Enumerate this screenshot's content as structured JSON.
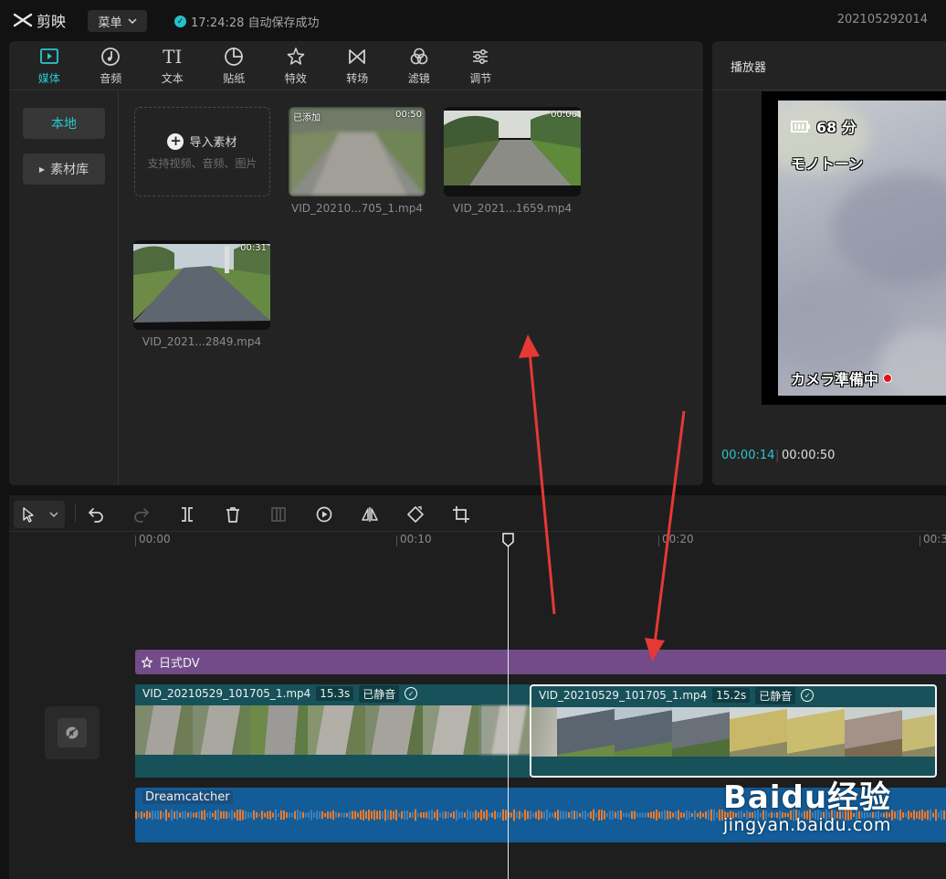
{
  "app": {
    "name": "剪映"
  },
  "titlebar": {
    "menu_label": "菜单",
    "autosave_text": "17:24:28 自动保存成功",
    "project_name": "202105292014"
  },
  "tool_tabs": [
    {
      "label": "媒体",
      "icon": "media-icon",
      "active": true
    },
    {
      "label": "音频",
      "icon": "audio-icon"
    },
    {
      "label": "文本",
      "icon": "text-icon"
    },
    {
      "label": "贴纸",
      "icon": "sticker-icon"
    },
    {
      "label": "特效",
      "icon": "effects-icon"
    },
    {
      "label": "转场",
      "icon": "transition-icon"
    },
    {
      "label": "滤镜",
      "icon": "filter-icon"
    },
    {
      "label": "调节",
      "icon": "adjust-icon"
    }
  ],
  "media_sidebar": {
    "local": "本地",
    "library": "素材库"
  },
  "import": {
    "label": "导入素材",
    "hint": "支持视频、音频、图片"
  },
  "media_items": [
    {
      "name": "VID_20210...705_1.mp4",
      "duration": "00:50",
      "badge": "已添加"
    },
    {
      "name": "VID_2021...1659.mp4",
      "duration": "00:06"
    },
    {
      "name": "VID_2021...2849.mp4",
      "duration": "00:31"
    }
  ],
  "player": {
    "title": "播放器",
    "current_time": "00:00:14",
    "separator": "|",
    "total_time": "00:00:50",
    "osd": {
      "battery": "68 分",
      "mode": "モノトーン",
      "status": "カメラ準備中"
    }
  },
  "ruler": {
    "labels": [
      "00:00",
      "00:10",
      "00:20",
      "00:3"
    ]
  },
  "tracks": {
    "effect": {
      "label": "日式DV"
    },
    "clips": [
      {
        "name": "VID_20210529_101705_1.mp4",
        "duration": "15.3s",
        "muted": "已静音"
      },
      {
        "name": "VID_20210529_101705_1.mp4",
        "duration": "15.2s",
        "muted": "已静音"
      }
    ],
    "audio": {
      "name": "Dreamcatcher"
    }
  },
  "watermark": {
    "brand": "Baidu经验",
    "url": "jingyan.baidu.com"
  },
  "colors": {
    "accent": "#2bc6ce",
    "effect_track": "#734b88",
    "video_track": "#17525b",
    "audio_track": "#135c97",
    "arrow": "#e53935"
  }
}
